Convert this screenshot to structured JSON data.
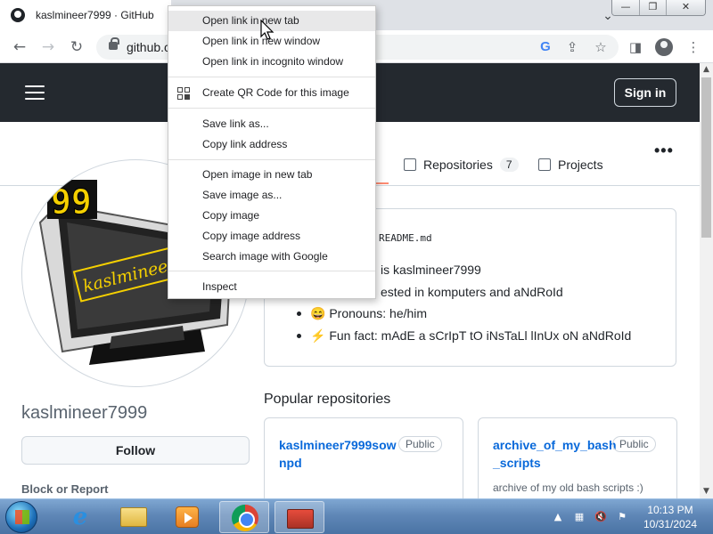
{
  "browser": {
    "tab_title": "kaslmineer7999 · GitHub",
    "url": "github.c",
    "window_buttons": [
      "—",
      "❐",
      "✕"
    ]
  },
  "header": {
    "signin_label": "Sign in"
  },
  "profile": {
    "username": "kaslmineer7999",
    "follow_label": "Follow",
    "block_report_label": "Block or Report",
    "avatar_text": "kaslmineer799",
    "avatar_badge": "99"
  },
  "nav": {
    "overview_fragment": "v",
    "repositories_label": "Repositories",
    "repositories_count": "7",
    "projects_label": "Projects"
  },
  "readme": {
    "filename": "README.md",
    "lines": [
      "is kaslmineer7999",
      "ested in komputers and aNdRoId",
      "😄 Pronouns: he/him",
      "⚡ Fun fact: mAdE a sCrIpT tO iNsTaLl lInUx oN aNdRoId"
    ]
  },
  "popular": {
    "title": "Popular repositories",
    "repos": [
      {
        "name": "kaslmineer7999sownpd",
        "badge": "Public",
        "description": ""
      },
      {
        "name": "archive_of_my_bash_scripts",
        "badge": "Public",
        "description": "archive of my old bash scripts :)"
      }
    ]
  },
  "context_menu": {
    "items": [
      "Open link in new tab",
      "Open link in new window",
      "Open link in incognito window",
      "Create QR Code for this image",
      "Save link as...",
      "Copy link address",
      "Open image in new tab",
      "Save image as...",
      "Copy image",
      "Copy image address",
      "Search image with Google",
      "Inspect"
    ]
  },
  "taskbar": {
    "time": "10:13 PM",
    "date": "10/31/2024"
  },
  "colors": {
    "header_bg": "#24292f",
    "link": "#0969da",
    "accent_underline": "#fd8c73"
  }
}
